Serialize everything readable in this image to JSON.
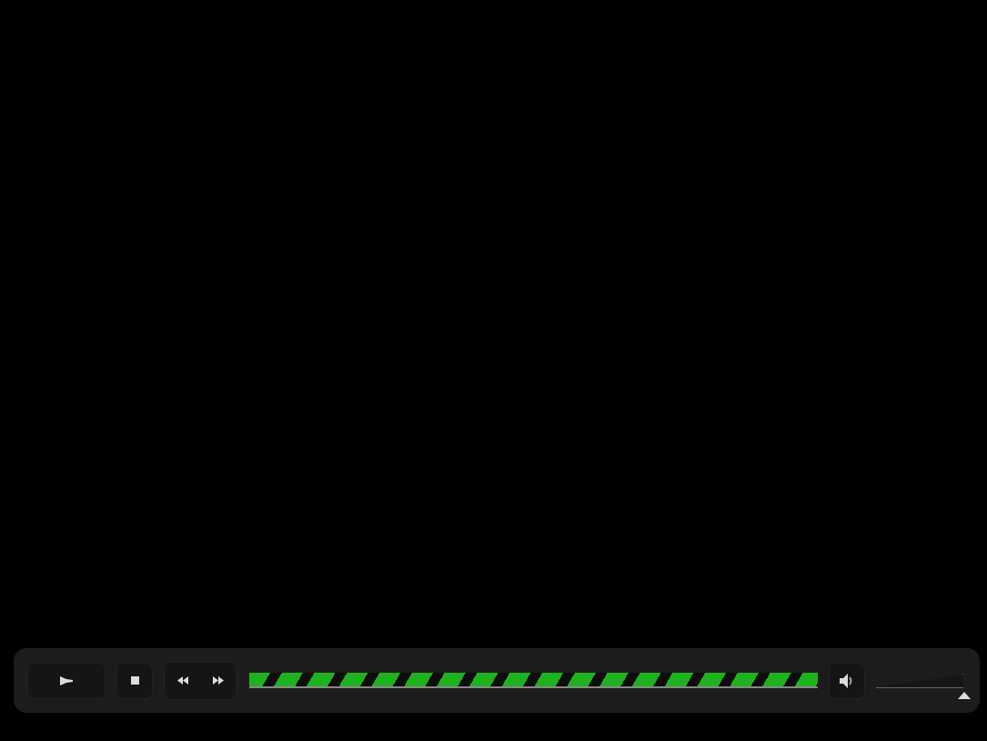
{
  "controls": {
    "progress": {
      "level": 1
    },
    "volume": {
      "level": 1
    }
  }
}
